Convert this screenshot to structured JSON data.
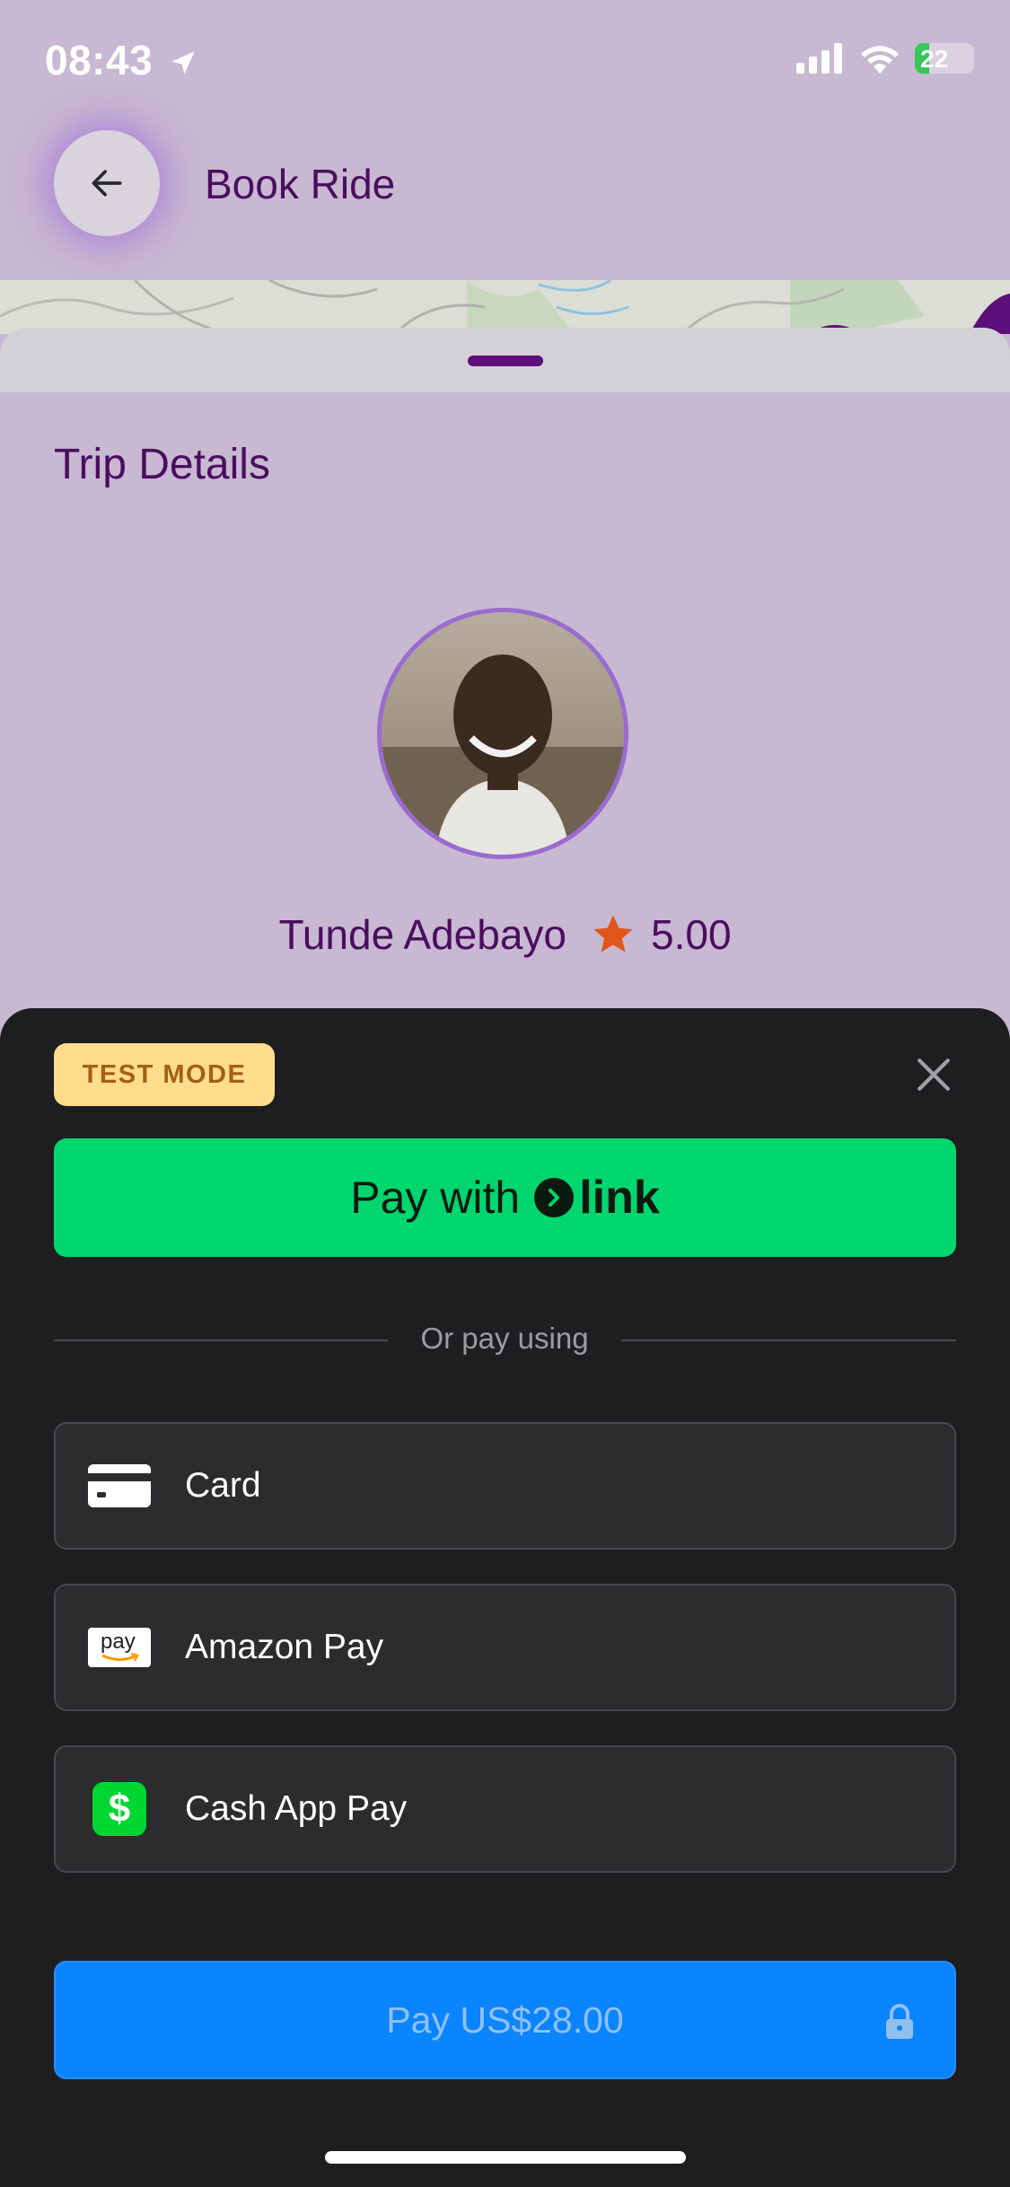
{
  "status_bar": {
    "time": "08:43",
    "battery": "22"
  },
  "header": {
    "title": "Book Ride"
  },
  "trip": {
    "title": "Trip Details"
  },
  "driver": {
    "name": "Tunde Adebayo",
    "rating": "5.00"
  },
  "sheet": {
    "badge": "TEST MODE",
    "link_button": {
      "prefix": "Pay with",
      "brand": "link"
    },
    "divider_text": "Or pay using",
    "methods": [
      {
        "label": "Card",
        "icon": "card-icon"
      },
      {
        "label": "Amazon Pay",
        "icon": "amazon-pay-icon",
        "icon_text": "pay"
      },
      {
        "label": "Cash App Pay",
        "icon": "cash-app-icon",
        "icon_text": "$"
      }
    ],
    "pay_button": "Pay US$28.00"
  },
  "colors": {
    "background": "#c8b8d2",
    "primary_text": "#4a0d5e",
    "link_green": "#00d66f",
    "pay_blue": "#0a84ff",
    "sheet_bg": "#1e1e20",
    "star": "#e0561a"
  }
}
